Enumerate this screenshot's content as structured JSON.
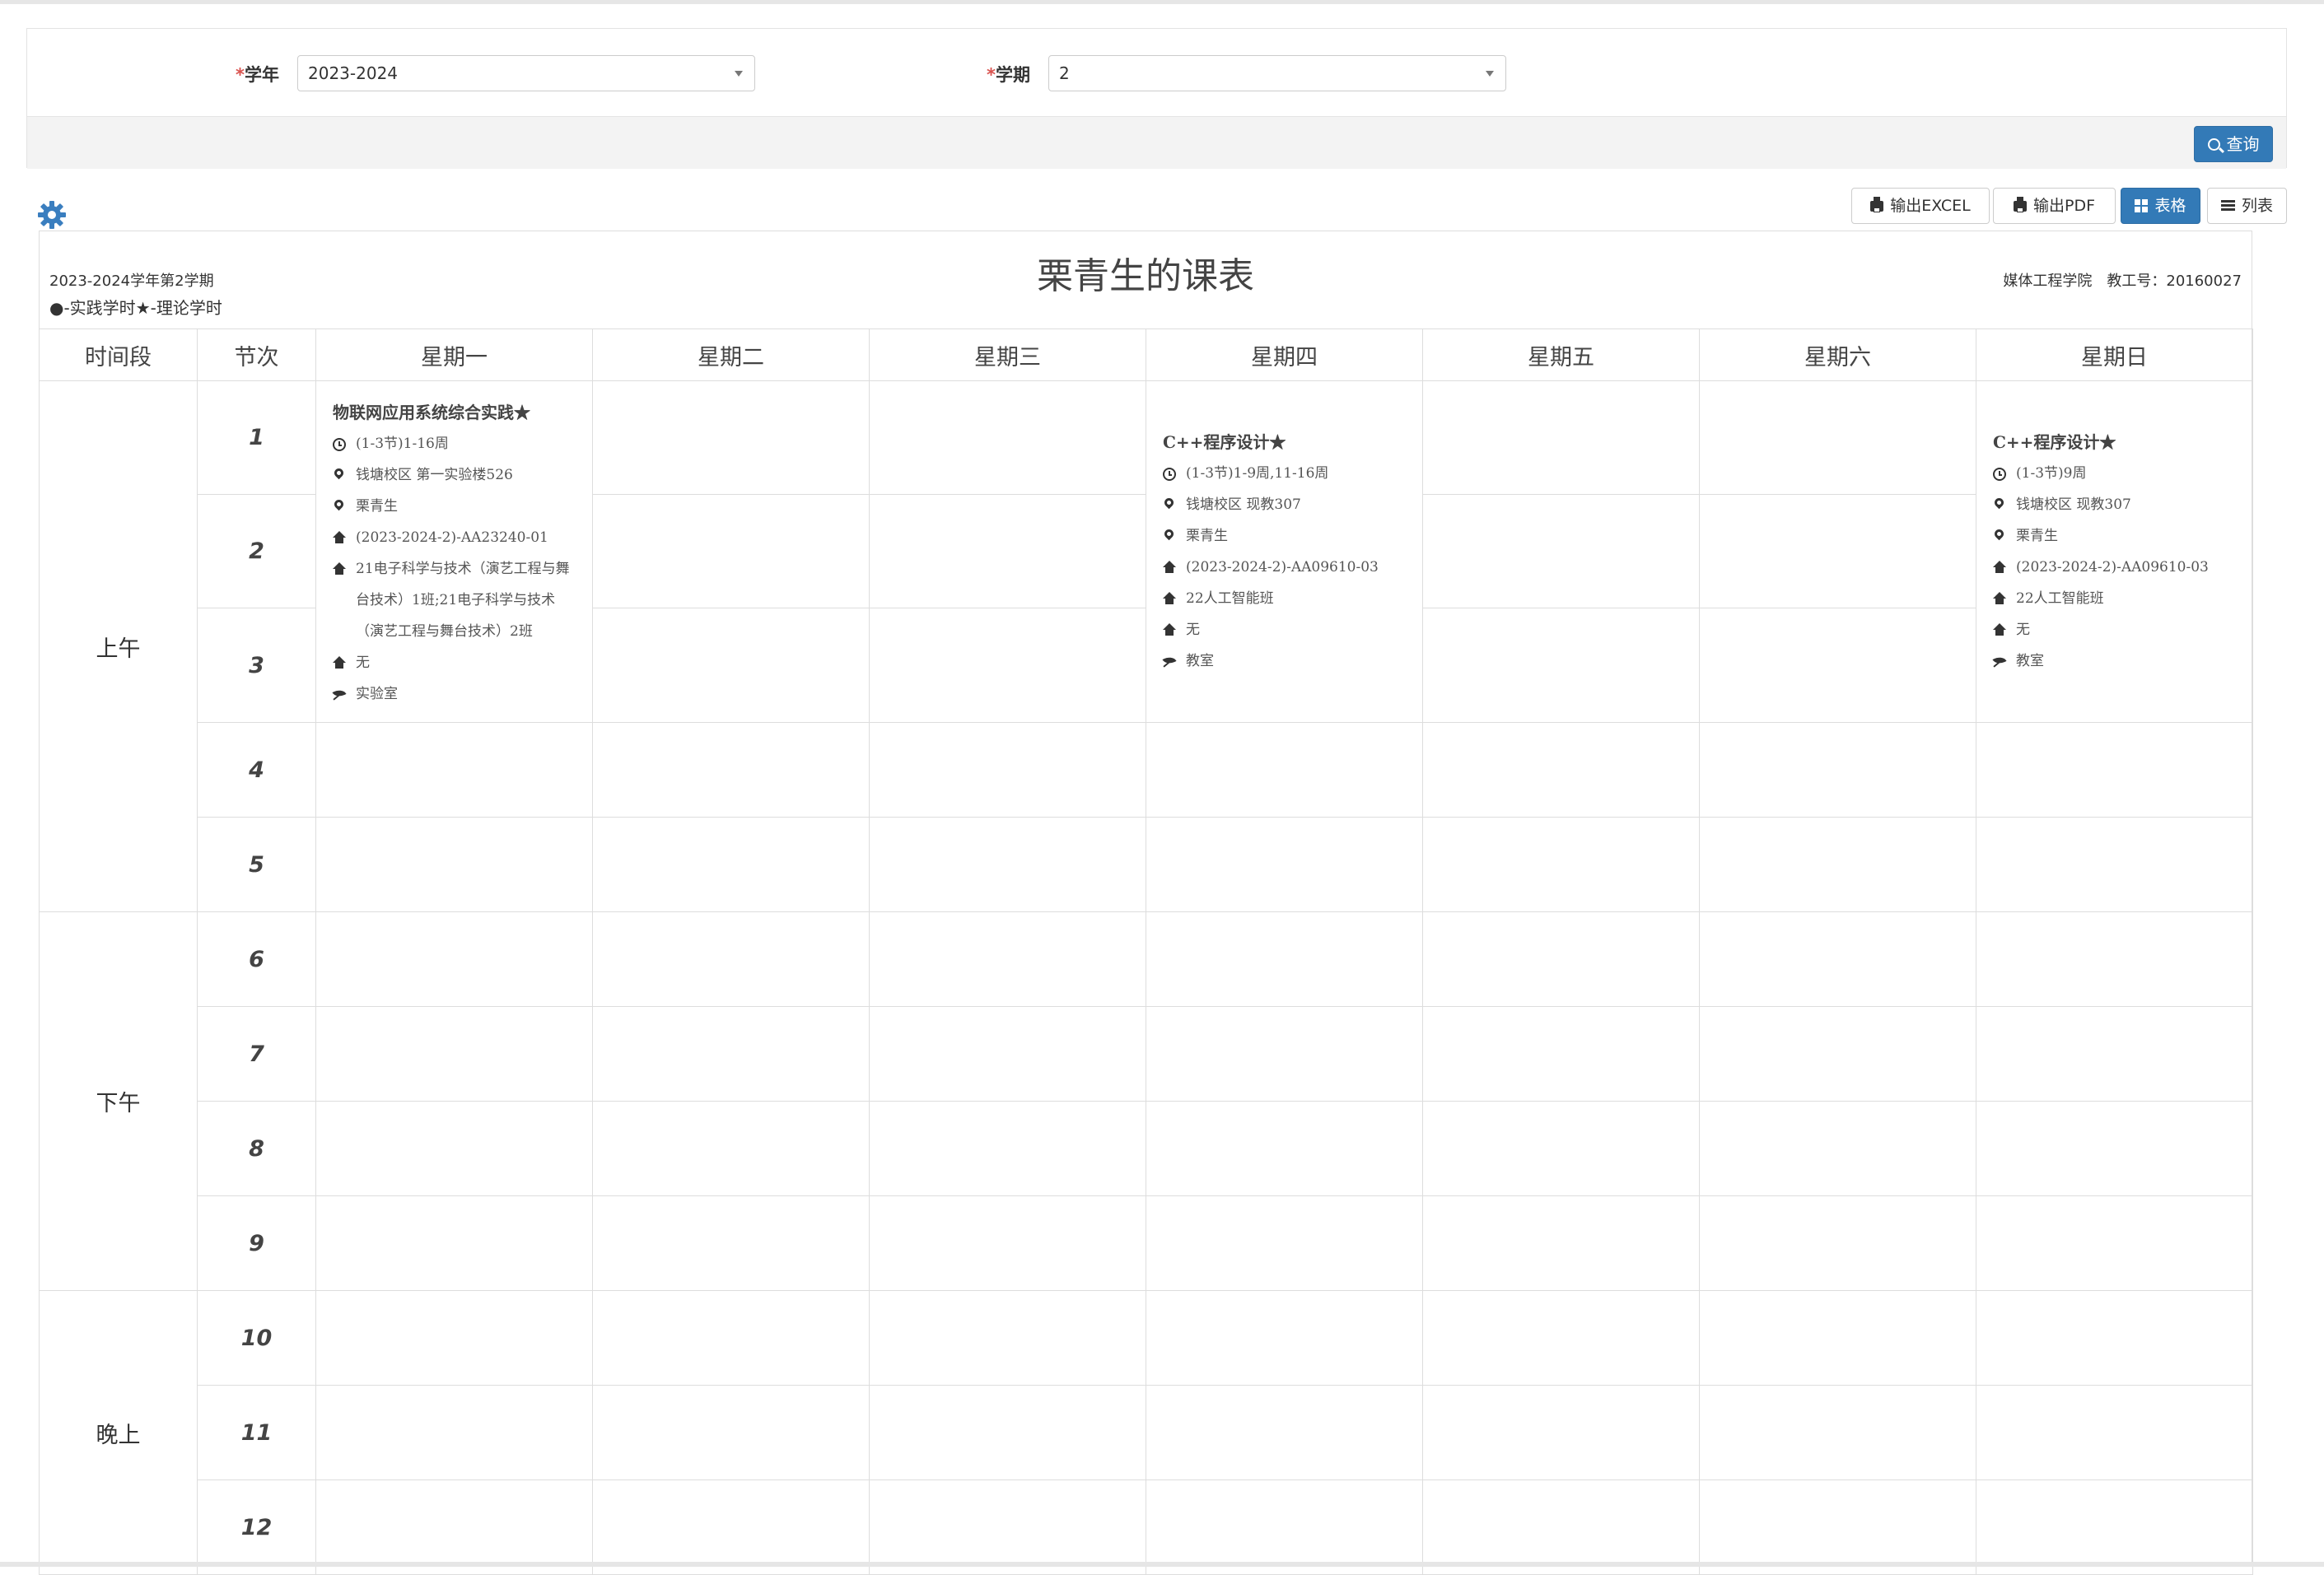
{
  "filters": {
    "year_label": "学年",
    "year_value": "2023-2024",
    "term_label": "学期",
    "term_value": "2",
    "required_mark": "*",
    "query_button": "查询"
  },
  "toolbar": {
    "export_excel": "输出EXCEL",
    "export_pdf": "输出PDF",
    "grid_view": "表格",
    "list_view": "列表"
  },
  "schedule": {
    "semester": "2023-2024学年第2学期",
    "legend": "●-实践学时★-理论学时",
    "title": "栗青生的课表",
    "college": "媒体工程学院",
    "staff_id": "教工号：20160027",
    "headers": [
      "时间段",
      "节次",
      "星期一",
      "星期二",
      "星期三",
      "星期四",
      "星期五",
      "星期六",
      "星期日"
    ],
    "periods": [
      "上午",
      "下午",
      "晚上"
    ],
    "sections": [
      "1",
      "2",
      "3",
      "4",
      "5",
      "6",
      "7",
      "8",
      "9",
      "10",
      "11",
      "12"
    ]
  },
  "courses": {
    "mon": {
      "name": "物联网应用系统综合实践★",
      "time": "(1-3节)1-16周",
      "location": "钱塘校区 第一实验楼526",
      "teacher": "栗青生",
      "class_code": "(2023-2024-2)-AA23240-01",
      "classes": "21电子科学与技术（演艺工程与舞台技术）1班;21电子科学与技术（演艺工程与舞台技术）2班",
      "extra": "无",
      "room_type": "实验室"
    },
    "thu": {
      "name": "C++程序设计★",
      "time": "(1-3节)1-9周,11-16周",
      "location": "钱塘校区 现教307",
      "teacher": "栗青生",
      "class_code": "(2023-2024-2)-AA09610-03",
      "classes": "22人工智能班",
      "extra": "无",
      "room_type": "教室"
    },
    "sun": {
      "name": "C++程序设计★",
      "time": "(1-3节)9周",
      "location": "钱塘校区 现教307",
      "teacher": "栗青生",
      "class_code": "(2023-2024-2)-AA09610-03",
      "classes": "22人工智能班",
      "extra": "无",
      "room_type": "教室"
    }
  },
  "colors": {
    "primary": "#337ab7",
    "required": "#d9534f",
    "border": "#dddddd",
    "gear": "#3a7ebf"
  },
  "icons": [
    "gear-icon",
    "search-icon",
    "printer-icon",
    "grid-icon",
    "list-icon",
    "clock-icon",
    "map-marker-icon",
    "home-icon",
    "leaf-icon",
    "caret-down-icon"
  ]
}
